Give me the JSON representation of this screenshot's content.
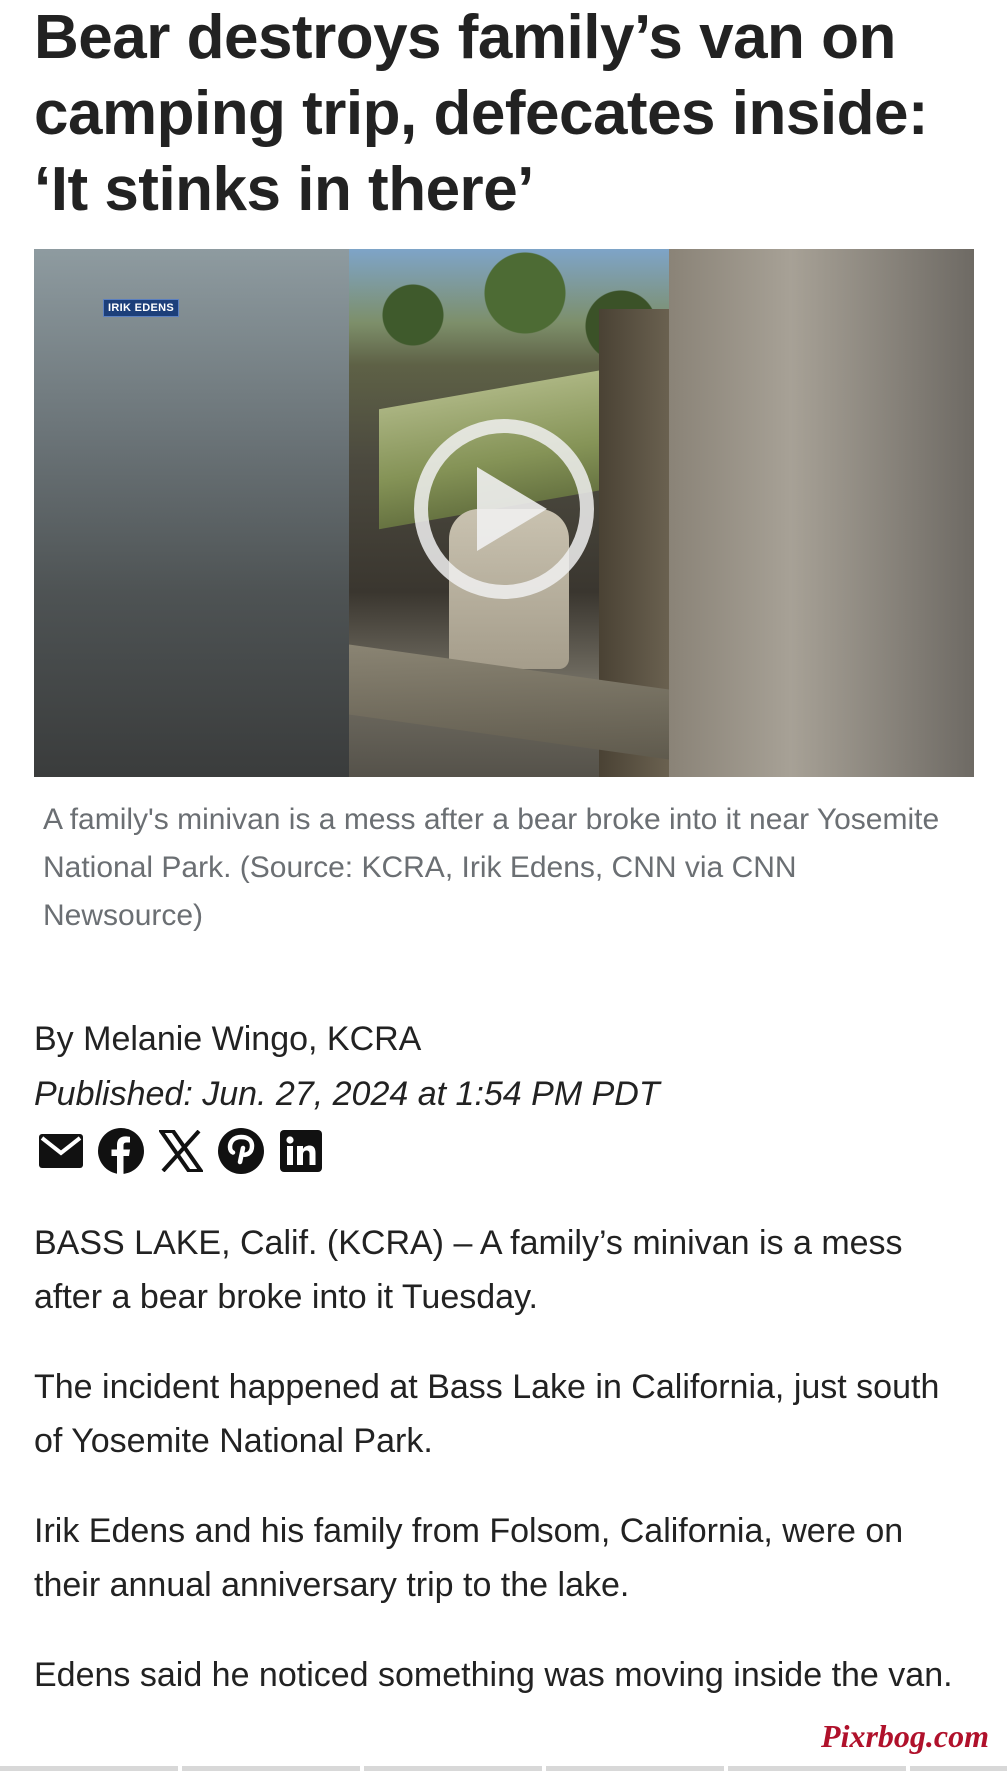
{
  "article": {
    "headline": "Bear destroys family’s van on camping trip, defecates inside: ‘It stinks in there’",
    "video": {
      "badge": "IRIK EDENS",
      "caption": "A family's minivan is a mess after a bear broke into it near Yosemite National Park. (Source: KCRA, Irik Edens, CNN via CNN Newsource)"
    },
    "byline": "By Melanie Wingo, KCRA",
    "published": "Published: Jun. 27, 2024 at 1:54 PM PDT",
    "share_icons": [
      "email-icon",
      "facebook-icon",
      "x-icon",
      "pinterest-icon",
      "linkedin-icon"
    ],
    "paragraphs": [
      "BASS LAKE, Calif. (KCRA) – A family’s minivan is a mess after a bear broke into it Tuesday.",
      "The incident happened at Bass Lake in California, just south of Yosemite National Park.",
      "Irik Edens and his family from Folsom, California, were on their annual anniversary trip to the lake.",
      "Edens said he noticed something was moving inside the van."
    ]
  },
  "watermark": "Pixrbog.com",
  "colors": {
    "text": "#222222",
    "caption": "#6b6f73",
    "badge": "#1d3f7a",
    "watermark": "#b0112b"
  }
}
